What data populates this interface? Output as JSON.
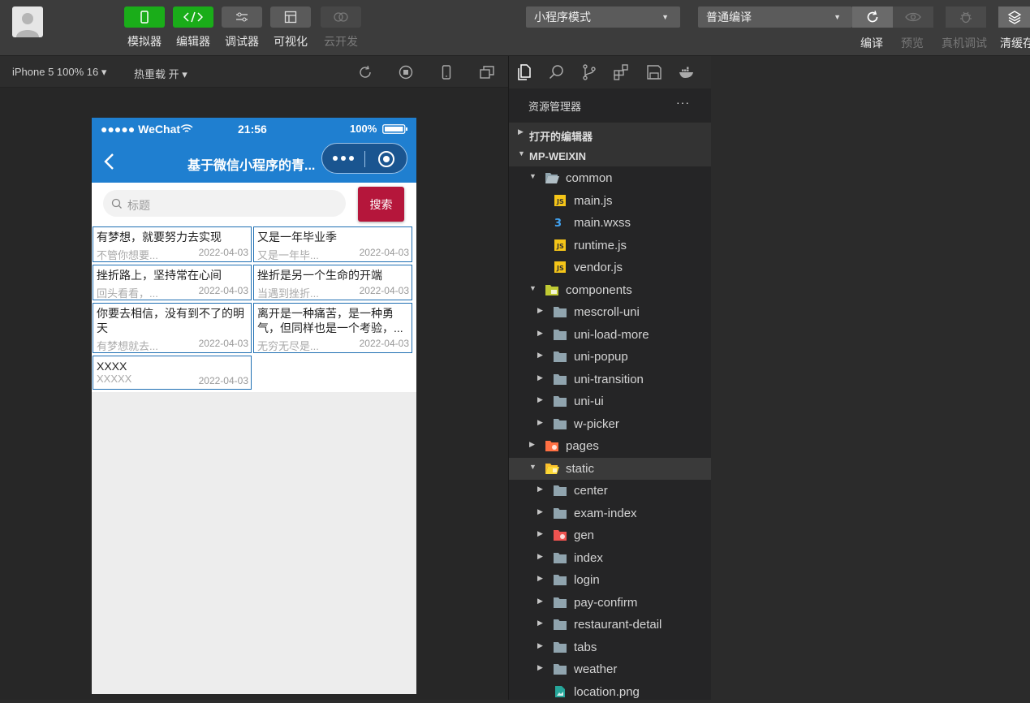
{
  "toolbar": {
    "tools": [
      {
        "label": "模拟器",
        "icon": "phone-icon"
      },
      {
        "label": "编辑器",
        "icon": "code-icon"
      },
      {
        "label": "调试器",
        "icon": "debug-sliders-icon"
      },
      {
        "label": "可视化",
        "icon": "layout-icon"
      },
      {
        "label": "云开发",
        "icon": "cloud-icon"
      }
    ],
    "mode_select": "小程序模式",
    "compile_select": "普通编译",
    "actions": [
      "编译",
      "预览",
      "真机调试",
      "清缓存"
    ]
  },
  "subbar": {
    "device": "iPhone 5 100% 16 ▾",
    "hot_reload": "热重载 开 ▾"
  },
  "phone": {
    "status": {
      "signal": "●●●●● WeChat",
      "time": "21:56",
      "battery": "100%"
    },
    "nav_title": "基于微信小程序的青...",
    "search_placeholder": "标题",
    "search_button": "搜索",
    "cards": [
      {
        "title": "有梦想，就要努力去实现",
        "summary": "不管你想要...",
        "date": "2022-04-03"
      },
      {
        "title": "又是一年毕业季",
        "summary": "又是一年毕...",
        "date": "2022-04-03"
      },
      {
        "title": "挫折路上，坚持常在心间",
        "summary": "回头看看，...",
        "date": "2022-04-03"
      },
      {
        "title": "挫折是另一个生命的开端",
        "summary": "当遇到挫折...",
        "date": "2022-04-03"
      },
      {
        "title": "你要去相信，没有到不了的明天",
        "summary": "有梦想就去...",
        "date": "2022-04-03"
      },
      {
        "title": "离开是一种痛苦，是一种勇气，但同样也是一个考验，...",
        "summary": "无穷无尽是...",
        "date": "2022-04-03"
      },
      {
        "title": "XXXX",
        "summary": "XXXXX",
        "date": "2022-04-03"
      }
    ]
  },
  "explorer": {
    "header": "资源管理器",
    "more": "···",
    "sections": [
      "打开的编辑器",
      "MP-WEIXIN"
    ],
    "tree": [
      {
        "label": "common",
        "type": "folder-open"
      },
      {
        "label": "main.js",
        "type": "js"
      },
      {
        "label": "main.wxss",
        "type": "css"
      },
      {
        "label": "runtime.js",
        "type": "js"
      },
      {
        "label": "vendor.js",
        "type": "js"
      },
      {
        "label": "components",
        "type": "folder-components"
      },
      {
        "label": "mescroll-uni",
        "type": "folder"
      },
      {
        "label": "uni-load-more",
        "type": "folder"
      },
      {
        "label": "uni-popup",
        "type": "folder"
      },
      {
        "label": "uni-transition",
        "type": "folder"
      },
      {
        "label": "uni-ui",
        "type": "folder"
      },
      {
        "label": "w-picker",
        "type": "folder"
      },
      {
        "label": "pages",
        "type": "folder-pages"
      },
      {
        "label": "static",
        "type": "folder-static"
      },
      {
        "label": "center",
        "type": "folder"
      },
      {
        "label": "exam-index",
        "type": "folder"
      },
      {
        "label": "gen",
        "type": "folder-gen"
      },
      {
        "label": "index",
        "type": "folder"
      },
      {
        "label": "login",
        "type": "folder"
      },
      {
        "label": "pay-confirm",
        "type": "folder"
      },
      {
        "label": "restaurant-detail",
        "type": "folder"
      },
      {
        "label": "tabs",
        "type": "folder"
      },
      {
        "label": "weather",
        "type": "folder"
      },
      {
        "label": "location.png",
        "type": "image"
      }
    ]
  }
}
